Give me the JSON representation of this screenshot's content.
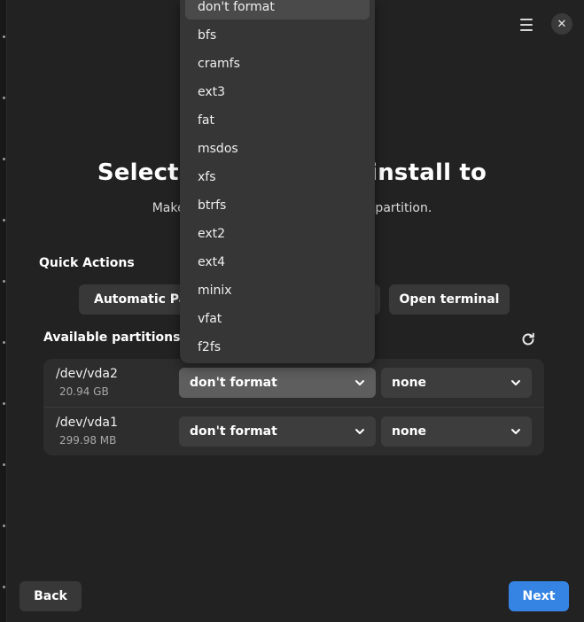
{
  "header": {
    "menu_icon": "hamburger-menu-icon",
    "close_icon": "close-icon",
    "close_glyph": "✕"
  },
  "page": {
    "title": "Select a partition to install to",
    "subtitle": "Make sure you have created a boot partition."
  },
  "quick_actions": {
    "label": "Quick Actions",
    "automatic_label": "Automatic Partitioning",
    "terminal_label": "Open terminal"
  },
  "partitions": {
    "label": "Available partitions",
    "refresh_icon": "refresh-icon",
    "rows": [
      {
        "device": "/dev/vda2",
        "size": "20.94 GB",
        "format": "don't format",
        "mount": "none"
      },
      {
        "device": "/dev/vda1",
        "size": "299.98 MB",
        "format": "don't format",
        "mount": "none"
      }
    ]
  },
  "format_dropdown": {
    "selected": "don't format",
    "options": [
      "don't format",
      "bfs",
      "cramfs",
      "ext3",
      "fat",
      "msdos",
      "xfs",
      "btrfs",
      "ext2",
      "ext4",
      "minix",
      "vfat",
      "f2fs"
    ]
  },
  "footer": {
    "back_label": "Back",
    "next_label": "Next"
  },
  "colors": {
    "accent": "#3584e4",
    "background": "#222222",
    "surface": "#2d2d2d"
  }
}
